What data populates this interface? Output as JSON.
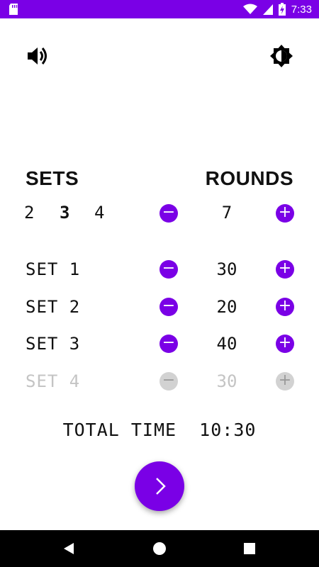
{
  "status_bar": {
    "time": "7:33",
    "bg_color": "#7a00e6"
  },
  "icons": {
    "sd_card": "sd-card-icon",
    "wifi": "wifi-icon",
    "signal": "signal-icon",
    "battery": "battery-charging-icon",
    "volume": "volume-icon",
    "brightness": "brightness-icon",
    "next": "chevron-right-icon"
  },
  "headings": {
    "sets": "SETS",
    "rounds": "ROUNDS"
  },
  "set_options": [
    "2",
    "3",
    "4"
  ],
  "selected_set_option": "3",
  "rounds": {
    "value": "7",
    "minus_label": "−",
    "plus_label": "+"
  },
  "sets": [
    {
      "label": "SET 1",
      "value": "30",
      "enabled": true
    },
    {
      "label": "SET 2",
      "value": "20",
      "enabled": true
    },
    {
      "label": "SET 3",
      "value": "40",
      "enabled": true
    },
    {
      "label": "SET 4",
      "value": "30",
      "enabled": false
    }
  ],
  "buttons": {
    "minus": "−",
    "plus": "+"
  },
  "total_time": "TOTAL TIME  10:30",
  "accent_color": "#7a00e6",
  "disabled_color": "#c4c4c4"
}
